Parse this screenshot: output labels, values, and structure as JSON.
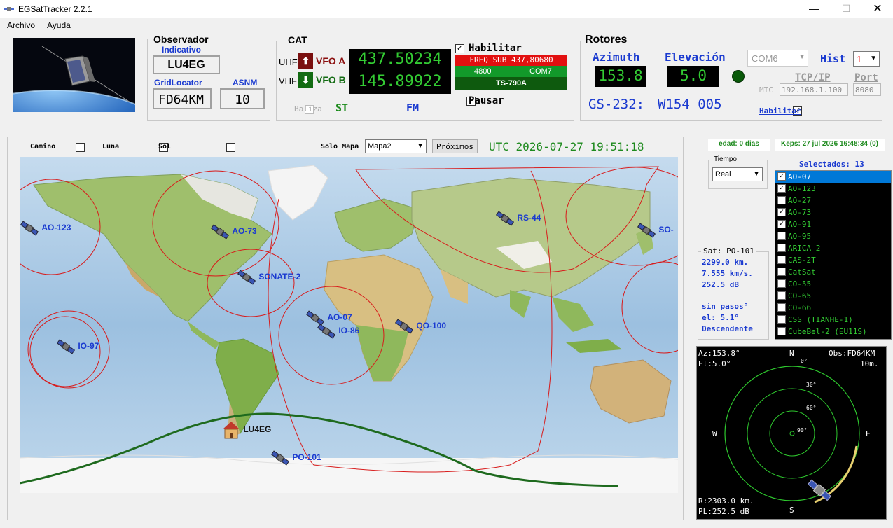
{
  "window": {
    "title": "EGSatTracker 2.2.1"
  },
  "menu": [
    "Archivo",
    "Ayuda"
  ],
  "observador": {
    "title": "Observador",
    "indicativo_label": "Indicativo",
    "indicativo": "LU4EG",
    "grid_label": "GridLocator",
    "grid": "FD64KM",
    "asnm_label": "ASNM",
    "asnm": "10"
  },
  "cat": {
    "title": "CAT",
    "uhf": "UHF",
    "vhf": "VHF",
    "vfo_a": "VFO A",
    "vfo_b": "VFO B",
    "freq_a": "437.50234",
    "freq_b": "145.89922",
    "habilitar": "Habilitar",
    "freq_sub": "FREQ SUB 437,80680",
    "baud": "4800",
    "com": "COM7",
    "radio": "TS-790A",
    "pausar": "Pausar",
    "baliza": "Baliza",
    "st": "ST",
    "mode": "FM"
  },
  "rotores": {
    "title": "Rotores",
    "az_label": "Azimuth",
    "az": "153.8",
    "el_label": "Elevación",
    "el": "5.0",
    "com": "COM6",
    "hist_label": "Hist",
    "hist": "1",
    "tcp_label": "TCP/IP",
    "port_label": "Port",
    "mtc": "MTC",
    "ip": "192.168.1.100",
    "port": "8080",
    "gs232_label": "GS-232:",
    "gs232": "W154 005",
    "habilitar": "Habilitar"
  },
  "map_toolbar": {
    "camino": "Camino",
    "luna": "Luna",
    "sol": "Sol",
    "solo_mapa": "Solo Mapa",
    "map_select": "Mapa2",
    "proximos": "Próximos",
    "utc": "UTC 2026-07-27 19:51:18"
  },
  "map": {
    "satellites": [
      {
        "name": "AO-123"
      },
      {
        "name": "AO-73"
      },
      {
        "name": "RS-44"
      },
      {
        "name": "SO-"
      },
      {
        "name": "SONATE-2"
      },
      {
        "name": "AO-07"
      },
      {
        "name": "IO-86"
      },
      {
        "name": "QO-100"
      },
      {
        "name": "IO-97"
      },
      {
        "name": "PO-101"
      }
    ],
    "home": "LU4EG"
  },
  "right": {
    "edad": "edad: 0 dias",
    "keps": "Keps: 27 jul 2026 16:48:34 (0)",
    "tiempo_label": "Tiempo",
    "tiempo": "Real",
    "selectados": "Selectados: 13"
  },
  "sat_list": [
    {
      "name": "AO-07",
      "checked": true,
      "selected": true
    },
    {
      "name": "AO-123",
      "checked": true
    },
    {
      "name": "AO-27",
      "checked": false
    },
    {
      "name": "AO-73",
      "checked": true
    },
    {
      "name": "AO-91",
      "checked": true
    },
    {
      "name": "AO-95",
      "checked": false
    },
    {
      "name": "ARICA 2",
      "checked": false
    },
    {
      "name": "CAS-2T",
      "checked": false
    },
    {
      "name": "CatSat",
      "checked": false
    },
    {
      "name": "CO-55",
      "checked": false
    },
    {
      "name": "CO-65",
      "checked": false
    },
    {
      "name": "CO-66",
      "checked": false
    },
    {
      "name": "CSS (TIANHE-1)",
      "checked": false
    },
    {
      "name": "CubeBel-2 (EU11S)",
      "checked": false
    }
  ],
  "sat_info": {
    "title": "Sat: PO-101",
    "range": "2299.0 km.",
    "speed": "7.555 km/s.",
    "pl": "252.5 dB",
    "passes": "sin pasos°",
    "el": "el: 5.1°",
    "dir": "Descendente"
  },
  "polar": {
    "az": "Az:153.8°",
    "el": "El:5.0°",
    "obs": "Obs:FD64KM",
    "min": "10m.",
    "n": "N",
    "s": "S",
    "e": "E",
    "w": "W",
    "r0": "0°",
    "r30": "30°",
    "r60": "60°",
    "r90": "90°",
    "range": "R:2303.0 km.",
    "pl": "PL:252.5 dB"
  }
}
